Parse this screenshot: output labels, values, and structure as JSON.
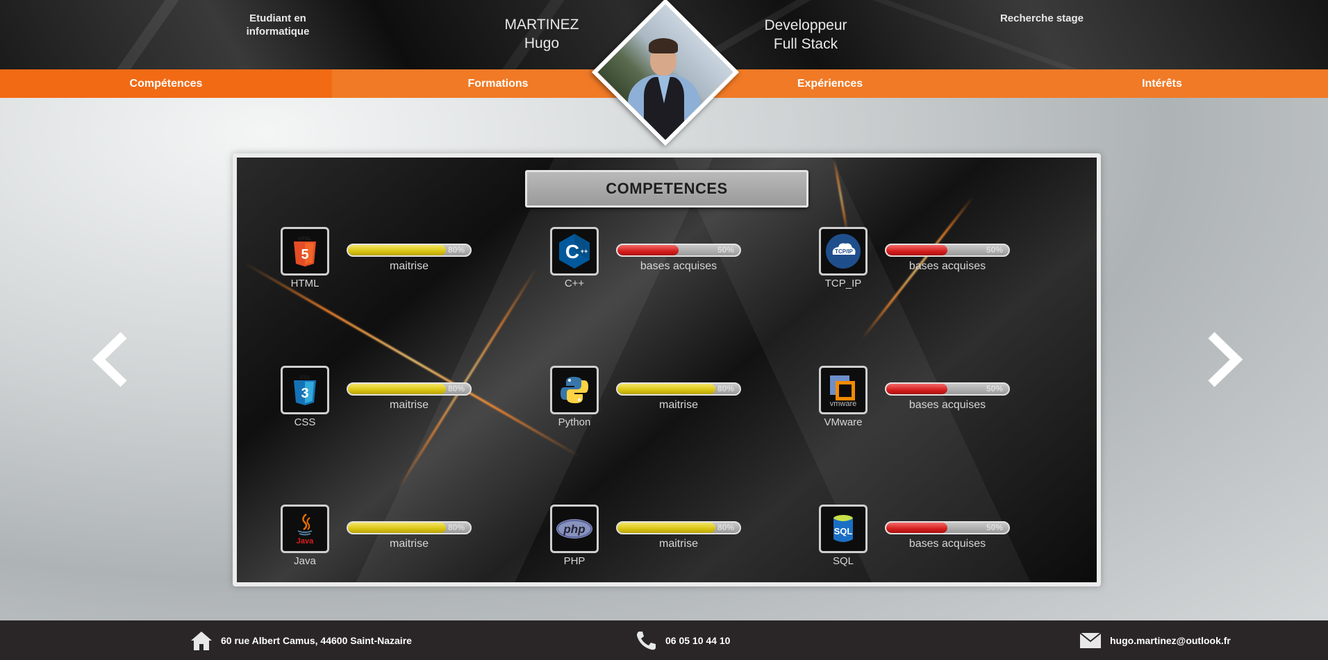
{
  "header": {
    "status_line1": "Etudiant en",
    "status_line2": "informatique",
    "last_name": "MARTINEZ",
    "first_name": "Hugo",
    "title_line1": "Developpeur",
    "title_line2": "Full Stack",
    "goal": "Recherche stage"
  },
  "nav": {
    "items": [
      {
        "label": "Compétences"
      },
      {
        "label": "Formations"
      },
      {
        "label": "Expériences"
      },
      {
        "label": "Intérêts"
      }
    ]
  },
  "panel": {
    "title": "COMPETENCES",
    "skills": [
      {
        "name": "HTML",
        "level": "maitrise",
        "percent_label": "80%",
        "progress": 0.8,
        "bar_color": "#d9c412",
        "icon": "html5-icon"
      },
      {
        "name": "C++",
        "level": "bases acquises",
        "percent_label": "50%",
        "progress": 0.5,
        "bar_color": "#d51e1e",
        "icon": "cplusplus-icon"
      },
      {
        "name": "TCP_IP",
        "level": "bases acquises",
        "percent_label": "50%",
        "progress": 0.5,
        "bar_color": "#d51e1e",
        "icon": "tcpip-icon"
      },
      {
        "name": "CSS",
        "level": "maitrise",
        "percent_label": "80%",
        "progress": 0.8,
        "bar_color": "#d9c412",
        "icon": "css3-icon"
      },
      {
        "name": "Python",
        "level": "maitrise",
        "percent_label": "80%",
        "progress": 0.8,
        "bar_color": "#d9c412",
        "icon": "python-icon"
      },
      {
        "name": "VMware",
        "level": "bases acquises",
        "percent_label": "50%",
        "progress": 0.5,
        "bar_color": "#d51e1e",
        "icon": "vmware-icon"
      },
      {
        "name": "Java",
        "level": "maitrise",
        "percent_label": "80%",
        "progress": 0.8,
        "bar_color": "#d9c412",
        "icon": "java-icon"
      },
      {
        "name": "PHP",
        "level": "maitrise",
        "percent_label": "80%",
        "progress": 0.8,
        "bar_color": "#d9c412",
        "icon": "php-icon"
      },
      {
        "name": "SQL",
        "level": "bases acquises",
        "percent_label": "50%",
        "progress": 0.5,
        "bar_color": "#d51e1e",
        "icon": "sql-icon"
      }
    ]
  },
  "footer": {
    "address": "60 rue Albert Camus, 44600 Saint-Nazaire",
    "phone": "06 05 10 44 10",
    "email": "hugo.martinez@outlook.fr"
  },
  "colors": {
    "accent": "#f07a26",
    "accent_active": "#f26a14",
    "footer_bg": "#2a2627"
  }
}
